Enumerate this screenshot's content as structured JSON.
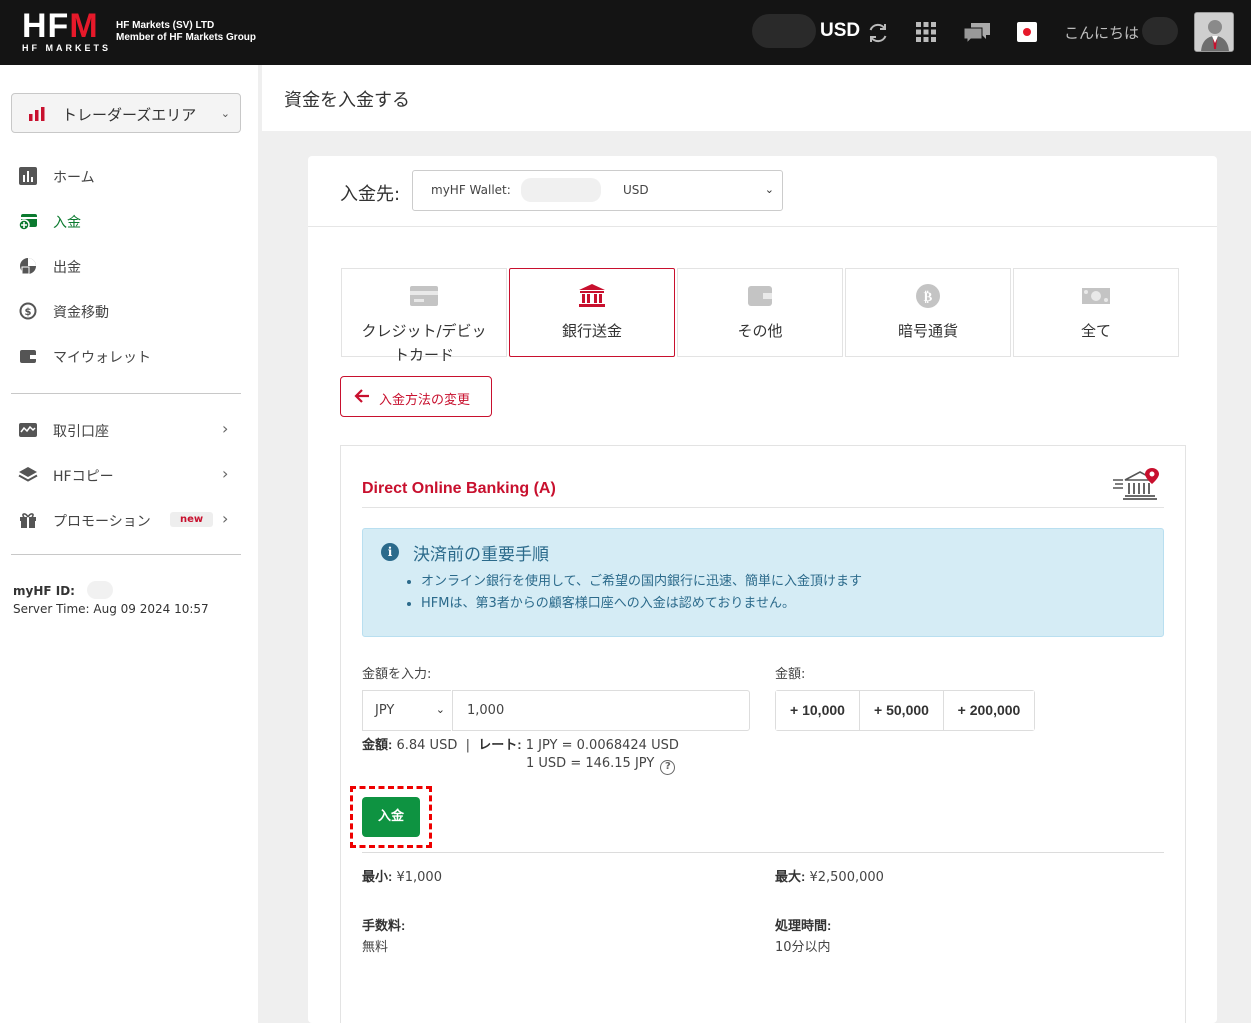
{
  "header": {
    "logo_text": "HFM",
    "logo_sub": "HF MARKETS",
    "company_line1": "HF Markets (SV) LTD",
    "company_line2": "Member of HF Markets Group",
    "currency": "USD",
    "greeting": "こんにちは",
    "icons": [
      "refresh-icon",
      "grid-icon",
      "chat-icon",
      "japan-flag-icon",
      "avatar"
    ]
  },
  "sidebar": {
    "area_select": "トレーダーズエリア",
    "items": [
      {
        "label": "ホーム",
        "icon": "chart-icon"
      },
      {
        "label": "入金",
        "icon": "deposit-icon",
        "active": true
      },
      {
        "label": "出金",
        "icon": "withdraw-icon"
      },
      {
        "label": "資金移動",
        "icon": "transfer-icon"
      },
      {
        "label": "マイウォレット",
        "icon": "wallet-icon"
      },
      {
        "label": "取引口座",
        "icon": "trading-account-icon",
        "has_arrow": true
      },
      {
        "label": "HFコピー",
        "icon": "layers-icon",
        "has_arrow": true
      },
      {
        "label": "プロモーション",
        "icon": "gift-icon",
        "badge": "new",
        "has_arrow": true
      }
    ],
    "myhf_id_label": "myHF ID:",
    "server_time": "Server Time: Aug 09 2024 10:57"
  },
  "page": {
    "title": "資金を入金する",
    "deposit_to_label": "入金先:",
    "wallet_label": "myHF Wallet:",
    "wallet_currency": "USD",
    "methods": [
      {
        "label": "クレジット/デビットカード",
        "icon": "credit-card-icon"
      },
      {
        "label": "銀行送金",
        "icon": "bank-icon",
        "active": true
      },
      {
        "label": "その他",
        "icon": "ewallet-icon"
      },
      {
        "label": "暗号通貨",
        "icon": "bitcoin-icon"
      },
      {
        "label": "全て",
        "icon": "cash-icon"
      }
    ],
    "change_method": "入金方法の変更"
  },
  "bank": {
    "title": "Direct Online Banking (A)",
    "info_title": "決済前の重要手順",
    "info_items": [
      "オンライン銀行を使用して、ご希望の国内銀行に迅速、簡単に入金頂けます",
      "HFMは、第3者からの顧客様口座への入金は認めておりません。"
    ],
    "amount_input_label": "金額を入力:",
    "quick_amount_label": "金額:",
    "currency": "JPY",
    "amount_value": "1,000",
    "quick_amounts": [
      "+ 10,000",
      "+ 50,000",
      "+ 200,000"
    ],
    "converted_label": "金額:",
    "converted_value": "6.84 USD",
    "rate_label": "レート:",
    "rate1": "1 JPY = 0.0068424 USD",
    "rate2": "1 USD = 146.15 JPY",
    "deposit_button": "入金",
    "min_label": "最小:",
    "min_value": "¥1,000",
    "max_label": "最大:",
    "max_value": "¥2,500,000",
    "fee_label": "手数料:",
    "fee_value": "無料",
    "time_label": "処理時間:",
    "time_value": "10分以内"
  },
  "colors": {
    "brand_red": "#c8102e",
    "deposit_green": "#0e9341",
    "info_blue": "#d5ecf5"
  }
}
